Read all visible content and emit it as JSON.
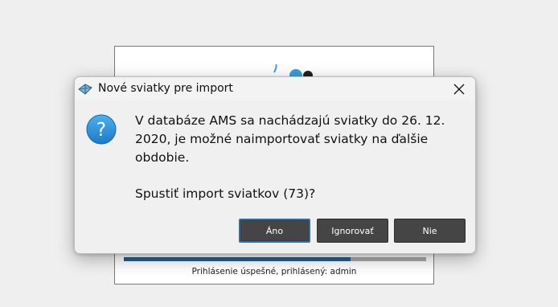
{
  "background_window": {
    "status_text": "Prihlásenie úspešné, prihlásený: admin",
    "progress_fraction": 0.75,
    "progress_color": "#1f5f94"
  },
  "dialog": {
    "title": "Nové sviatky pre import",
    "icon": "question-icon",
    "message_line1": "V databáze AMS sa nachádzajú sviatky do 26. 12.",
    "message_line2": "2020, je možné naimportovať sviatky na ďalšie",
    "message_line3": "obdobie.",
    "question": "Spustiť import sviatkov (73)?",
    "buttons": {
      "yes": "Áno",
      "ignore": "Ignorovať",
      "no": "Nie"
    },
    "close_symbol": "✕"
  },
  "colors": {
    "accent": "#2d6fa8",
    "button_bg": "#454545",
    "question_icon_bg": "#1e8ad6"
  }
}
